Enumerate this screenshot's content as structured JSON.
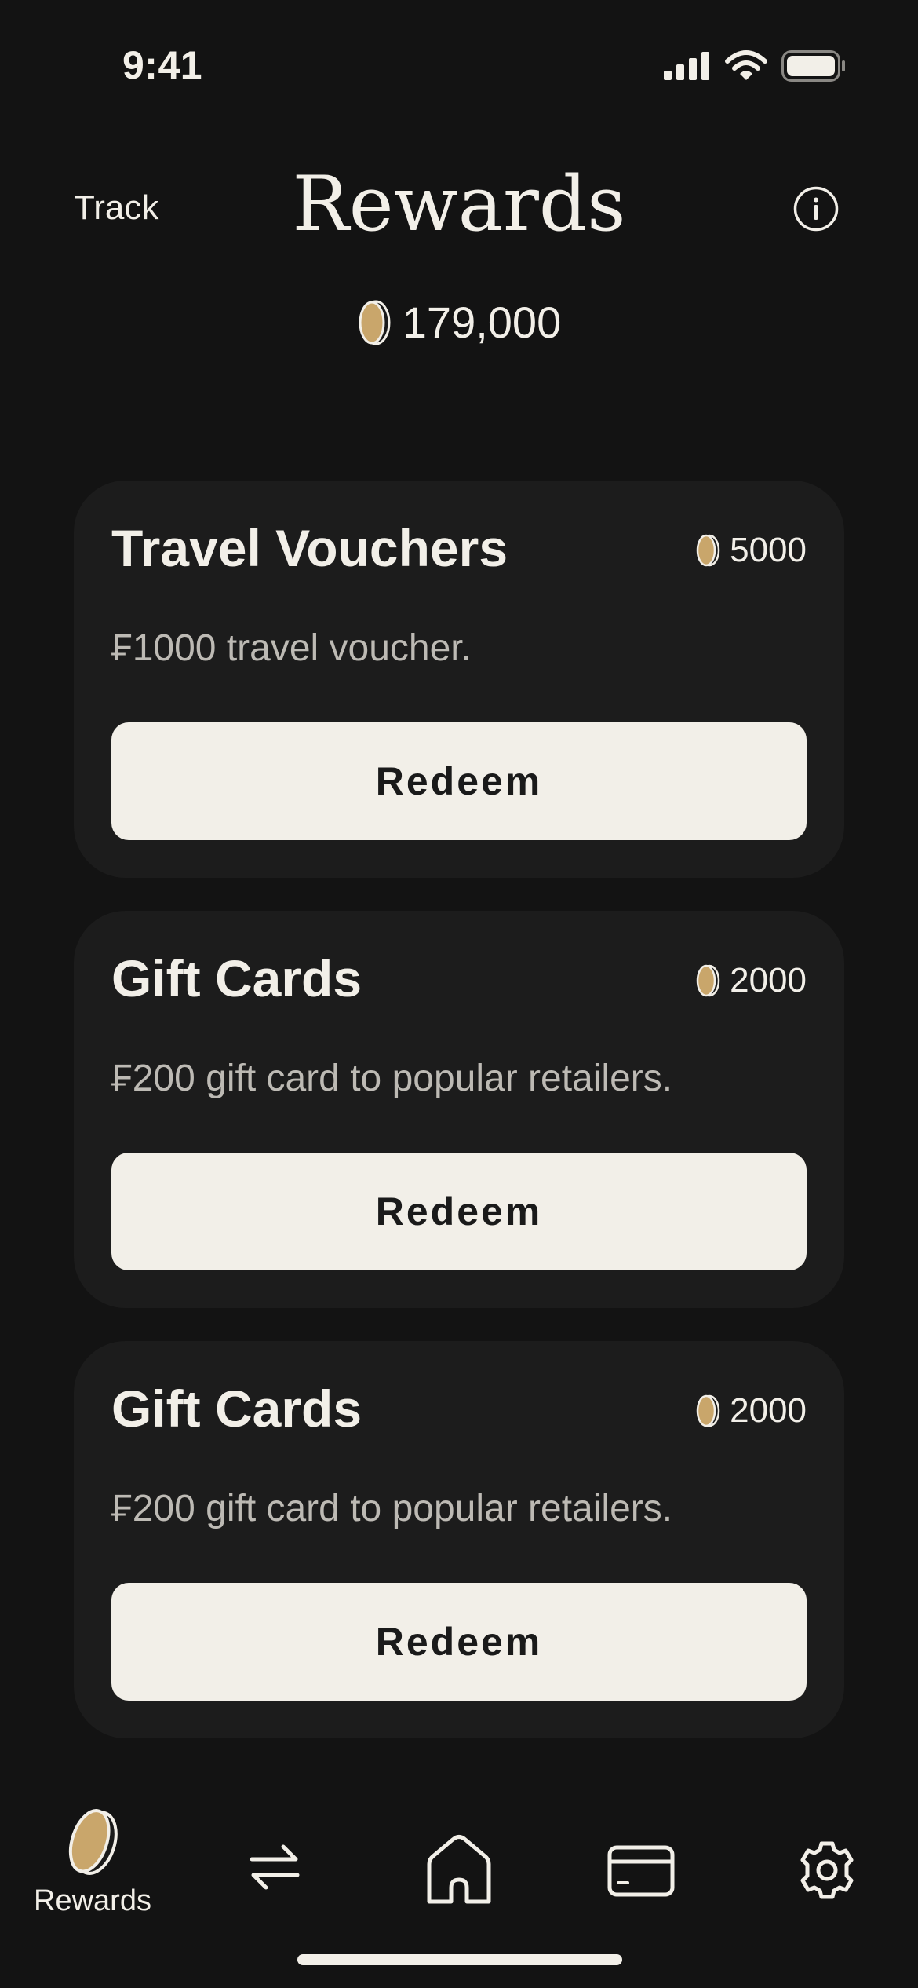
{
  "status": {
    "time": "9:41"
  },
  "header": {
    "track_label": "Track",
    "title": "Rewards"
  },
  "balance": {
    "value": "179,000"
  },
  "rewards": [
    {
      "title": "Travel Vouchers",
      "cost": "5000",
      "description": "₣1000 travel voucher.",
      "button": "Redeem"
    },
    {
      "title": "Gift Cards",
      "cost": "2000",
      "description": "₣200 gift card to popular retailers.",
      "button": "Redeem"
    },
    {
      "title": "Gift Cards",
      "cost": "2000",
      "description": "₣200 gift card to popular retailers.",
      "button": "Redeem"
    }
  ],
  "tab_bar": {
    "rewards_label": "Rewards",
    "icons": [
      "coin-icon",
      "transfer-icon",
      "home-icon",
      "card-icon",
      "settings-icon"
    ]
  },
  "colors": {
    "background": "#131313",
    "card": "#1c1c1c",
    "button": "#f2efe8",
    "coin": "#c9a66b"
  }
}
